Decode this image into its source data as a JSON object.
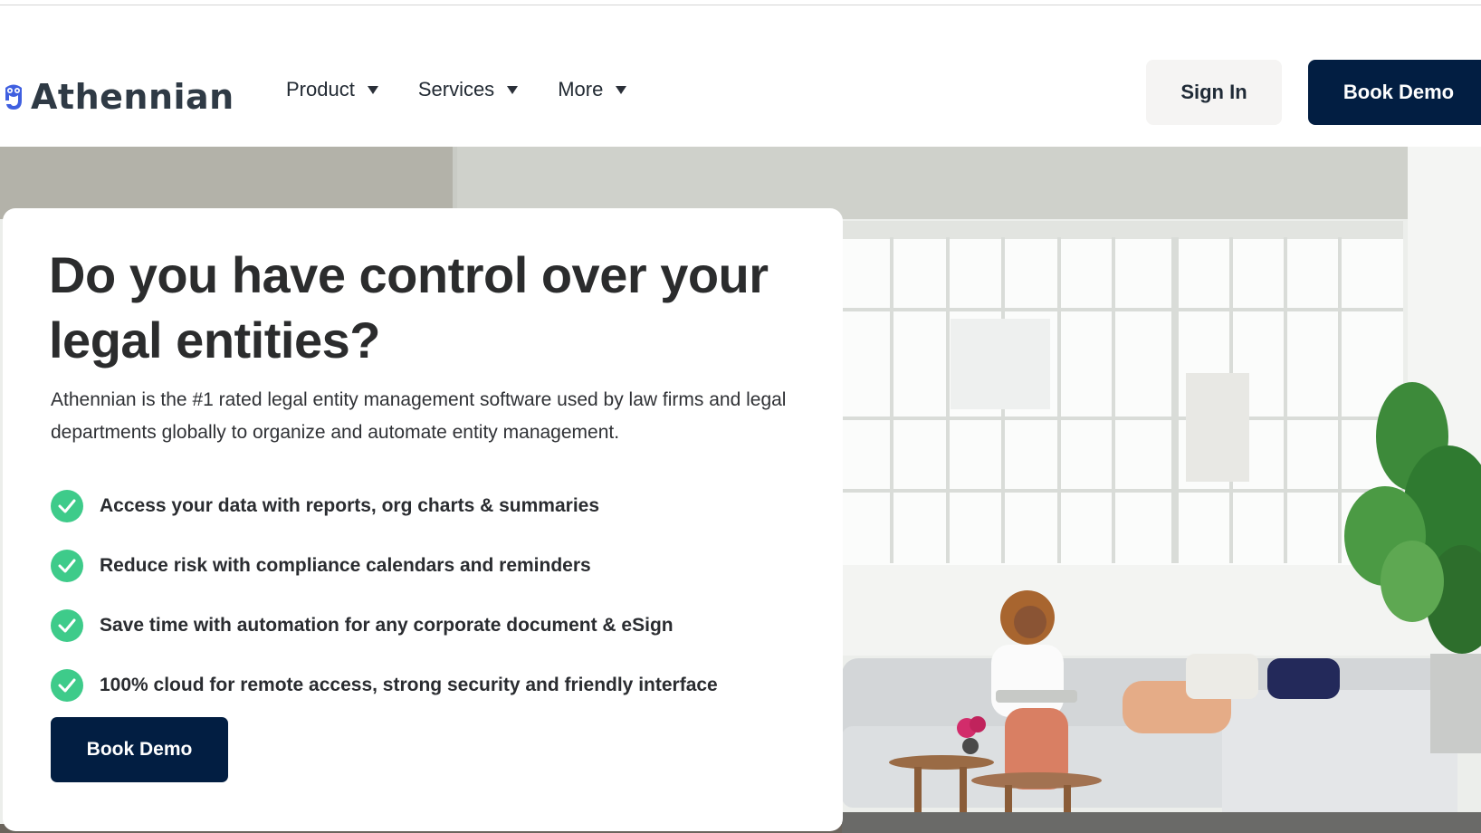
{
  "header": {
    "brand_name": "Athennian",
    "nav": [
      {
        "label": "Product",
        "icon": "caret-down-icon"
      },
      {
        "label": "Services",
        "icon": "caret-down-icon"
      },
      {
        "label": "More",
        "icon": "caret-down-icon"
      }
    ],
    "sign_in_label": "Sign In",
    "book_demo_label": "Book Demo"
  },
  "hero": {
    "headline": "Do you have control over your legal entities?",
    "description": "Athennian is the #1 rated legal entity management software used by law firms and legal departments globally to organize and automate entity management.",
    "features": [
      {
        "icon": "check-circle-icon",
        "text": "Access your data with reports, org charts & summaries"
      },
      {
        "icon": "check-circle-icon",
        "text": "Reduce risk with compliance calendars and reminders"
      },
      {
        "icon": "check-circle-icon",
        "text": "Save time with automation for any corporate document & eSign"
      },
      {
        "icon": "check-circle-icon",
        "text": "100% cloud for remote access, strong security and friendly interface"
      }
    ],
    "cta_label": "Book Demo",
    "image_alt": "Woman reading a magazine on a grey sofa in a bright loft with large windows and a fiddle-leaf fig plant"
  },
  "colors": {
    "primary_navy": "#021e42",
    "check_green": "#3ecb8a",
    "signin_bg": "#f5f4f3",
    "logo_blue": "#3f5fe0",
    "text_dark": "#2b2c2d"
  }
}
